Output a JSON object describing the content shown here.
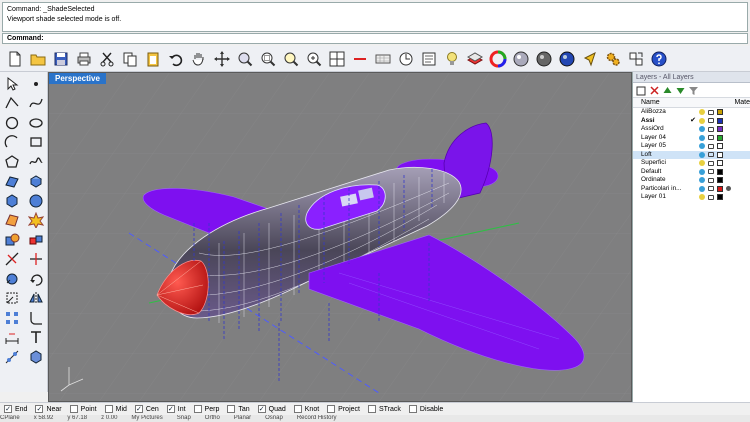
{
  "command_history": {
    "line1": "Command: _ShadeSelected",
    "line2": "Viewport shade selected mode is off."
  },
  "command_prompt": {
    "label": "Command:",
    "value": ""
  },
  "viewport": {
    "title": "Perspective"
  },
  "layers_panel": {
    "title": "Layers - All Layers",
    "columns": {
      "name": "Name",
      "material": "Mate"
    },
    "rows": [
      {
        "name": "AliBozza",
        "current": false,
        "color": "#c8a000",
        "bulb": "#e8d040"
      },
      {
        "name": "Assi",
        "current": true,
        "color": "#1b2fb8",
        "bulb": "#e8d040"
      },
      {
        "name": "AssiOrd",
        "current": false,
        "color": "#7a2dc4",
        "bulb": "#38a0d8"
      },
      {
        "name": "Layer 04",
        "current": false,
        "color": "#2aa830",
        "bulb": "#38a0d8"
      },
      {
        "name": "Layer 05",
        "current": false,
        "color": "#ffffff",
        "bulb": "#38a0d8"
      },
      {
        "name": "Loft",
        "current": false,
        "color": "#ffffff",
        "bulb": "#38a0d8",
        "selected": true
      },
      {
        "name": "Superfici",
        "current": false,
        "color": "#ffffff",
        "bulb": "#e8d040"
      },
      {
        "name": "Default",
        "current": false,
        "color": "#000000",
        "bulb": "#38a0d8"
      },
      {
        "name": "Ordinate",
        "current": false,
        "color": "#000000",
        "bulb": "#38a0d8"
      },
      {
        "name": "Particolari in...",
        "current": false,
        "color": "#d81818",
        "bulb": "#38a0d8",
        "material": true
      },
      {
        "name": "Layer 01",
        "current": false,
        "color": "#000000",
        "bulb": "#e8d040"
      }
    ]
  },
  "osnaps": [
    {
      "label": "End",
      "checked": true
    },
    {
      "label": "Near",
      "checked": true
    },
    {
      "label": "Point",
      "checked": false
    },
    {
      "label": "Mid",
      "checked": false
    },
    {
      "label": "Cen",
      "checked": true
    },
    {
      "label": "Int",
      "checked": true
    },
    {
      "label": "Perp",
      "checked": false
    },
    {
      "label": "Tan",
      "checked": false
    },
    {
      "label": "Quad",
      "checked": true
    },
    {
      "label": "Knot",
      "checked": false
    },
    {
      "label": "Project",
      "checked": false
    },
    {
      "label": "STrack",
      "checked": false
    },
    {
      "label": "Disable",
      "checked": false
    }
  ],
  "status_readout": {
    "cplane": "CPlane",
    "x": "x 58.92",
    "y": "y 67.18",
    "z": "z 0.00",
    "layer": "My Pictures",
    "snap": "Snap",
    "ortho": "Ortho",
    "planar": "Planar",
    "osnap": "Osnap",
    "history": "Record History"
  },
  "toolbar_icons": [
    "new-file-icon",
    "open-folder-icon",
    "save-icon",
    "print-icon",
    "cut-icon",
    "copy-icon",
    "paste-icon",
    "undo-icon",
    "pan-hand-icon",
    "rotate-view-icon",
    "zoom-extents-icon",
    "zoom-window-icon",
    "zoom-selected-icon",
    "zoom-icon",
    "four-viewports-icon",
    "grid-snap-icon",
    "cplane-icon",
    "point-edit-icon",
    "object-properties-icon",
    "lightbulb-icon",
    "layer-icon",
    "color-wheel-icon",
    "render-sphere-icon",
    "shaded-sphere-icon",
    "rendered-sphere-icon",
    "cursor-arrow-icon",
    "settings-gears-icon",
    "options-icon",
    "help-icon"
  ],
  "colors": {
    "viewport_bg": "#7f7f80",
    "aircraft_purple": "#7e10f0",
    "spinner_red": "#e32020",
    "viewport_tab": "#2a73c9"
  }
}
